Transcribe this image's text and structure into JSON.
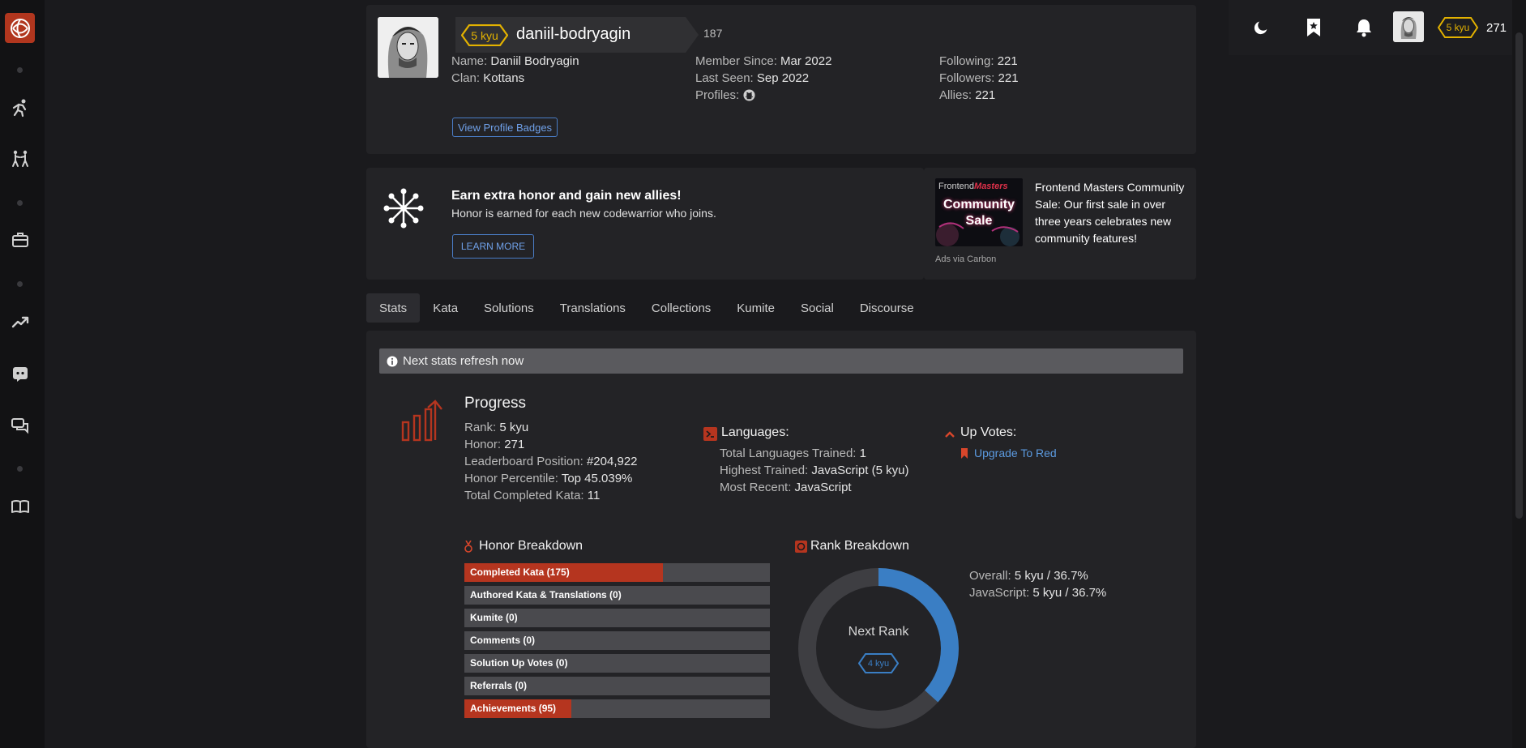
{
  "profile": {
    "rank_badge": "5 kyu",
    "username": "daniil-bodryagin",
    "honor_count": "187",
    "name_label": "Name:",
    "name_value": "Daniil Bodryagin",
    "clan_label": "Clan:",
    "clan_value": "Kottans",
    "member_since_label": "Member Since:",
    "member_since_value": "Mar 2022",
    "last_seen_label": "Last Seen:",
    "last_seen_value": "Sep 2022",
    "profiles_label": "Profiles:",
    "following_label": "Following:",
    "following_value": "221",
    "followers_label": "Followers:",
    "followers_value": "221",
    "allies_label": "Allies:",
    "allies_value": "221",
    "view_badges_button": "View Profile Badges"
  },
  "referral": {
    "title": "Earn extra honor and gain new allies!",
    "subtitle": "Honor is earned for each new codewarrior who joins.",
    "button": "LEARN MORE"
  },
  "ad": {
    "brand_line1": "Frontend",
    "brand_line2": "Masters",
    "promo_line1": "Community",
    "promo_line2": "Sale",
    "text": "Frontend Masters Community Sale: Our first sale in over three years celebrates new community features!",
    "footer": "Ads via Carbon"
  },
  "tabs": [
    "Stats",
    "Kata",
    "Solutions",
    "Translations",
    "Collections",
    "Kumite",
    "Social",
    "Discourse"
  ],
  "notice": "Next stats refresh now",
  "progress": {
    "title": "Progress",
    "rank_label": "Rank:",
    "rank_value": "5 kyu",
    "honor_label": "Honor:",
    "honor_value": "271",
    "leaderboard_label": "Leaderboard Position:",
    "leaderboard_value": "#204,922",
    "percentile_label": "Honor Percentile:",
    "percentile_value": "Top 45.039%",
    "completed_label": "Total Completed Kata:",
    "completed_value": "11"
  },
  "languages": {
    "title": "Languages:",
    "total_label": "Total Languages Trained:",
    "total_value": "1",
    "highest_label": "Highest Trained:",
    "highest_value": "JavaScript (5 kyu)",
    "recent_label": "Most Recent:",
    "recent_value": "JavaScript"
  },
  "upvotes": {
    "title": "Up Votes:",
    "link": "Upgrade To Red"
  },
  "honor_breakdown": {
    "title": "Honor Breakdown",
    "rows": [
      {
        "label": "Completed Kata (175)",
        "fill": 0.65
      },
      {
        "label": "Authored Kata & Translations (0)",
        "fill": 0
      },
      {
        "label": "Kumite (0)",
        "fill": 0
      },
      {
        "label": "Comments (0)",
        "fill": 0
      },
      {
        "label": "Solution Up Votes (0)",
        "fill": 0
      },
      {
        "label": "Referrals (0)",
        "fill": 0
      },
      {
        "label": "Achievements (95)",
        "fill": 0.35
      }
    ]
  },
  "rank_breakdown": {
    "title": "Rank Breakdown",
    "center_label": "Next Rank",
    "next_rank_badge": "4 kyu",
    "progress_percent": 36.7,
    "overall_label": "Overall:",
    "overall_value": "5 kyu / 36.7%",
    "js_label": "JavaScript:",
    "js_value": "5 kyu / 36.7%"
  },
  "topnav": {
    "rank_badge": "5 kyu",
    "honor": "271"
  },
  "colors": {
    "accent_red": "#b5351f",
    "rank_yellow": "#e3b200",
    "link_blue": "#6fa0e8",
    "ring_blue": "#3a7ec4"
  }
}
